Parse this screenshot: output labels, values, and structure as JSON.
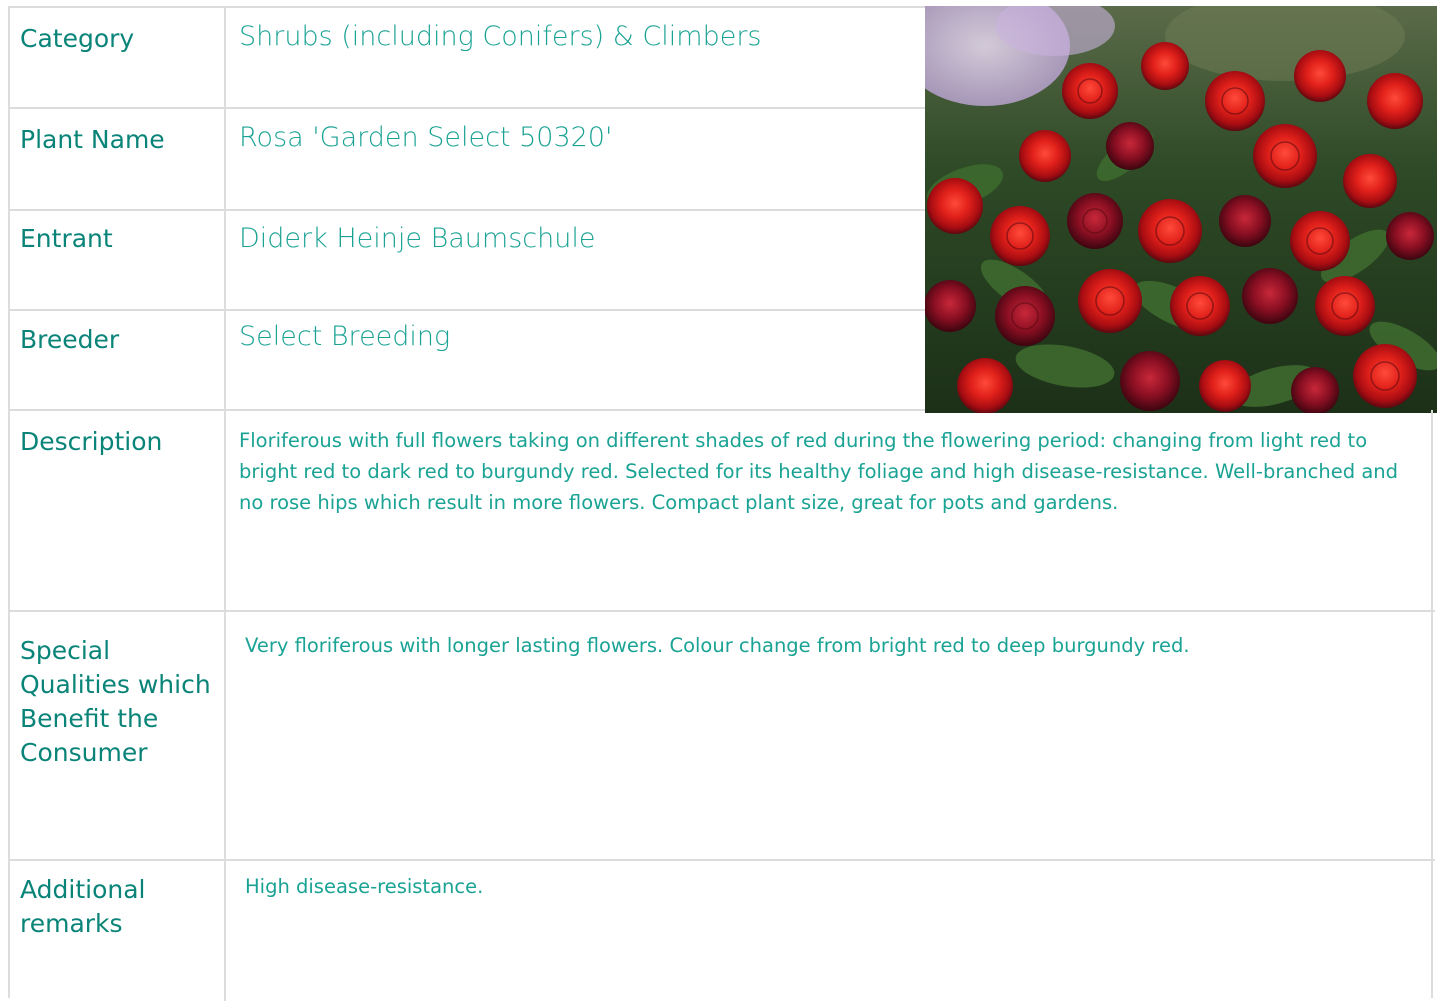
{
  "rows": {
    "category": {
      "label": "Category",
      "value": "Shrubs (including Conifers) & Climbers"
    },
    "plant_name": {
      "label": "Plant Name",
      "value": "Rosa 'Garden Select 50320'"
    },
    "entrant": {
      "label": "Entrant",
      "value": "Diderk Heinje Baumschule"
    },
    "breeder": {
      "label": "Breeder",
      "value": "Select Breeding"
    },
    "description": {
      "label": "Description",
      "value": "Floriferous with full flowers taking on different shades of red during the flowering period: changing from light red to bright red to dark red to burgundy red. Selected for its healthy foliage and high disease-resistance. Well-branched and no rose hips which result in more flowers. Compact plant size, great for pots and gardens."
    },
    "special_qualities": {
      "label": "Special Qualities which Benefit the Consumer",
      "value": "Very floriferous with longer lasting flowers. Colour change from bright red to deep burgundy red."
    },
    "additional_remarks": {
      "label": "Additional remarks",
      "value": "High disease-resistance."
    }
  },
  "colors": {
    "label_text": "#0a8478",
    "value_text": "#1aa394",
    "border": "#dcdcdc"
  },
  "photo": {
    "subject": "red-roses-photo"
  }
}
